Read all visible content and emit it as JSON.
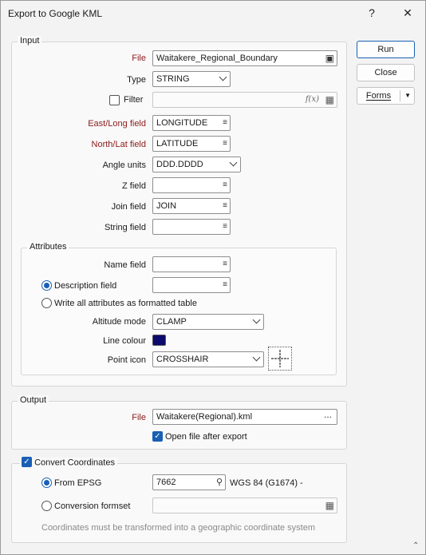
{
  "window": {
    "title": "Export to Google KML",
    "help": "?",
    "close": "✕"
  },
  "buttons": {
    "run": "Run",
    "close": "Close",
    "forms": "Forms"
  },
  "input": {
    "group_title": "Input",
    "file": {
      "label": "File",
      "value": "Waitakere_Regional_Boundary"
    },
    "type": {
      "label": "Type",
      "value": "STRING"
    },
    "filter": {
      "label": "Filter",
      "checked": false,
      "fx": "f(x)"
    },
    "east": {
      "label": "East/Long field",
      "value": "LONGITUDE"
    },
    "north": {
      "label": "North/Lat field",
      "value": "LATITUDE"
    },
    "angle": {
      "label": "Angle units",
      "value": "DDD.DDDD"
    },
    "z": {
      "label": "Z field",
      "value": ""
    },
    "join": {
      "label": "Join field",
      "value": "JOIN"
    },
    "string": {
      "label": "String field",
      "value": ""
    }
  },
  "attributes": {
    "group_title": "Attributes",
    "name_field": {
      "label": "Name field",
      "value": ""
    },
    "description": {
      "label": "Description field",
      "value": "",
      "selected": true
    },
    "write_all": {
      "label": "Write all attributes as formatted table",
      "selected": false
    },
    "altitude": {
      "label": "Altitude mode",
      "value": "CLAMP"
    },
    "line_colour": {
      "label": "Line colour",
      "color": "#0b0b6e"
    },
    "point_icon": {
      "label": "Point icon",
      "value": "CROSSHAIR"
    }
  },
  "output": {
    "group_title": "Output",
    "file": {
      "label": "File",
      "value": "Waitakere(Regional).kml",
      "browse": "..."
    },
    "open_after": {
      "label": "Open file after export",
      "checked": true
    }
  },
  "convert": {
    "label": "Convert Coordinates",
    "checked": true,
    "from_epsg": {
      "label": "From EPSG",
      "value": "7662",
      "selected": true,
      "desc": "WGS 84 (G1674) -"
    },
    "conversion_formset": {
      "label": "Conversion formset",
      "value": "",
      "selected": false
    },
    "note": "Coordinates must be transformed into a geographic coordinate system"
  }
}
